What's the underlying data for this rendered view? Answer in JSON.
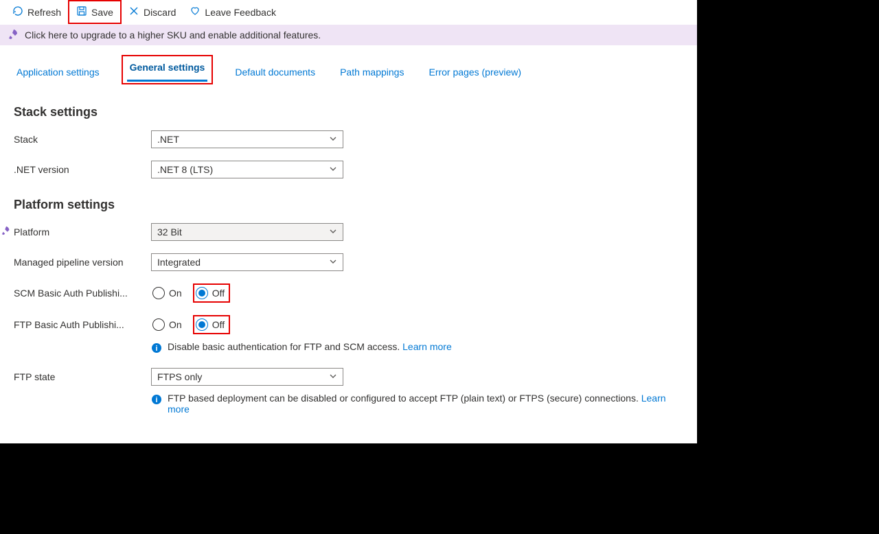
{
  "toolbar": {
    "refresh": "Refresh",
    "save": "Save",
    "discard": "Discard",
    "feedback": "Leave Feedback"
  },
  "banner": {
    "text": "Click here to upgrade to a higher SKU and enable additional features."
  },
  "tabs": {
    "app_settings": "Application settings",
    "general": "General settings",
    "default_docs": "Default documents",
    "path_mappings": "Path mappings",
    "error_pages": "Error pages (preview)"
  },
  "sections": {
    "stack": {
      "title": "Stack settings",
      "stack_label": "Stack",
      "stack_value": ".NET",
      "version_label": ".NET version",
      "version_value": ".NET 8 (LTS)"
    },
    "platform": {
      "title": "Platform settings",
      "platform_label": "Platform",
      "platform_value": "32 Bit",
      "pipeline_label": "Managed pipeline version",
      "pipeline_value": "Integrated",
      "scm_label": "SCM Basic Auth Publishi...",
      "ftp_label": "FTP Basic Auth Publishi...",
      "on": "On",
      "off": "Off",
      "auth_info": "Disable basic authentication for FTP and SCM access.",
      "auth_learn": "Learn more",
      "ftp_state_label": "FTP state",
      "ftp_state_value": "FTPS only",
      "ftp_state_info": "FTP based deployment can be disabled or configured to accept FTP (plain text) or FTPS (secure) connections.",
      "ftp_state_learn": "Learn more"
    }
  }
}
